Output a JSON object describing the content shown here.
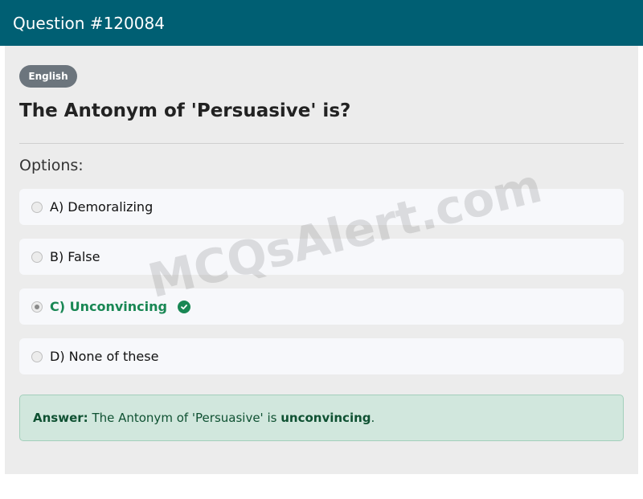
{
  "header": {
    "title": "Question #120084"
  },
  "badge": {
    "label": "English"
  },
  "question": {
    "text": "The Antonym of 'Persuasive' is?"
  },
  "options_label": "Options:",
  "options": [
    {
      "label": "A) Demoralizing",
      "selected": false,
      "correct": false
    },
    {
      "label": "B) False",
      "selected": false,
      "correct": false
    },
    {
      "label": "C) Unconvincing",
      "selected": true,
      "correct": true
    },
    {
      "label": "D) None of these",
      "selected": false,
      "correct": false
    }
  ],
  "answer": {
    "prefix": "Answer:",
    "sentence": "The Antonym of 'Persuasive' is",
    "highlight": "unconvincing",
    "suffix": "."
  },
  "watermark": "MCQsAlert.com",
  "colors": {
    "header_bg": "#005f73",
    "correct_green": "#198754",
    "answer_bg": "#d1e7dd",
    "badge_bg": "#6c757d"
  }
}
